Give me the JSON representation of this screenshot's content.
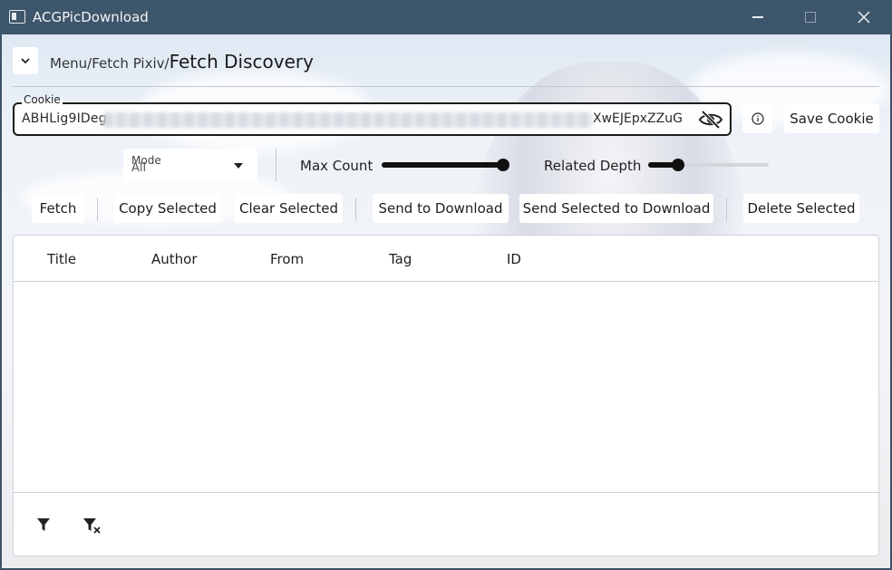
{
  "window": {
    "title": "ACGPicDownload",
    "icon": "app-window-icon"
  },
  "breadcrumb": {
    "items": [
      "Menu/",
      "Fetch Pixiv/"
    ],
    "current": "Fetch Discovery"
  },
  "cookie": {
    "label": "Cookie",
    "value_start": "ABHLig9IDeg",
    "value_end": "XwEJEpxZZuG",
    "visibility_icon": "eye-off-icon"
  },
  "toolbar": {
    "info_icon": "info-icon",
    "save_cookie_label": "Save Cookie"
  },
  "mode": {
    "label": "Mode",
    "value": "All"
  },
  "max_count": {
    "label": "Max Count",
    "level": 1.0
  },
  "related_depth": {
    "label": "Related Depth",
    "level": 0.25
  },
  "actions": {
    "fetch": "Fetch",
    "copy_selected": "Copy Selected",
    "clear_selected": "Clear Selected",
    "send_to_download": "Send to Download",
    "send_selected_to_download": "Send Selected to Download",
    "delete_selected": "Delete Selected"
  },
  "table": {
    "columns": [
      "Title",
      "Author",
      "From",
      "Tag",
      "ID"
    ],
    "rows": [],
    "footer_icons": [
      "filter-icon",
      "clear-filter-icon"
    ]
  }
}
